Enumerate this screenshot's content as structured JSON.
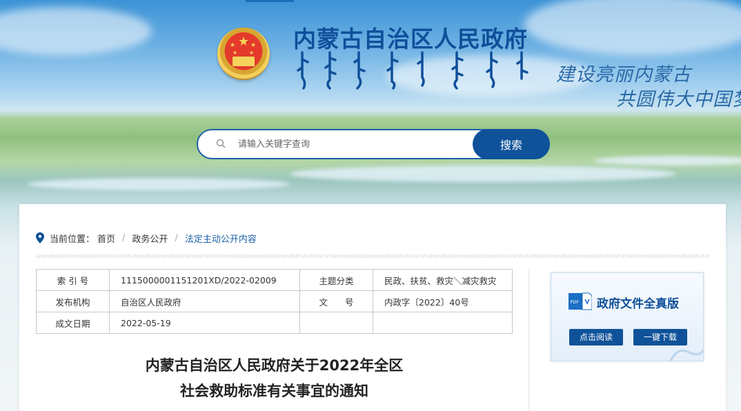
{
  "header": {
    "site_title": "内蒙古自治区人民政府",
    "slogan_line1": "建设亮丽内蒙古",
    "slogan_line2": "共圆伟大中国梦"
  },
  "search": {
    "placeholder": "请输入关键字查询",
    "button_label": "搜索"
  },
  "breadcrumb": {
    "prefix": "当前位置：",
    "items": [
      "首页",
      "政务公开",
      "法定主动公开内容"
    ]
  },
  "meta_table": {
    "rows": [
      {
        "label1": "索 引 号",
        "value1": "1115000001151201XD/2022-02009",
        "label2": "主题分类",
        "value2": "民政、扶贫、救灾＼减灾救灾"
      },
      {
        "label1": "发布机构",
        "value1": "自治区人民政府",
        "label2": "文　　号",
        "value2": "内政字〔2022〕40号"
      },
      {
        "label1": "成文日期",
        "value1": "2022-05-19",
        "label2": "",
        "value2": ""
      }
    ]
  },
  "document": {
    "title_line1": "内蒙古自治区人民政府关于2022年全区",
    "title_line2": "社会救助标准有关事宜的通知"
  },
  "pdf_card": {
    "title": "政府文件全真版",
    "icon_text": "PDF",
    "read_label": "点击阅读",
    "download_label": "一键下载"
  },
  "colors": {
    "primary": "#0f5299",
    "title_blue": "#0f4f9a",
    "link_blue": "#1b5fa8"
  }
}
